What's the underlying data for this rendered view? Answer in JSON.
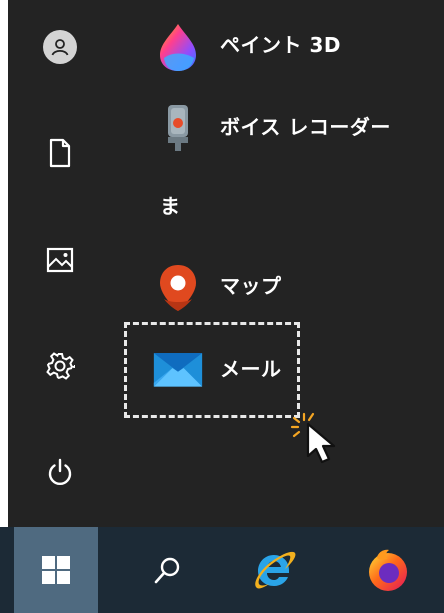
{
  "rail": {
    "items": [
      {
        "icon": "user-icon"
      },
      {
        "icon": "document-icon"
      },
      {
        "icon": "pictures-icon"
      },
      {
        "icon": "settings-gear-icon"
      },
      {
        "icon": "power-icon"
      }
    ]
  },
  "apps": {
    "paint3d": {
      "label": "ペイント 3D",
      "icon": "paint-3d-icon"
    },
    "voice_recorder": {
      "label": "ボイス レコーダー",
      "icon": "microphone-icon"
    },
    "group_letter": "ま",
    "maps": {
      "label": "マップ",
      "icon": "map-pin-icon"
    },
    "mail": {
      "label": "メール",
      "icon": "mail-envelope-icon"
    }
  },
  "taskbar": {
    "items": [
      {
        "icon": "windows-start-icon"
      },
      {
        "icon": "search-icon"
      },
      {
        "icon": "internet-explorer-icon"
      },
      {
        "icon": "firefox-icon"
      }
    ]
  },
  "colors": {
    "menu_bg": "#232323",
    "taskbar_bg": "#1c2a36",
    "start_highlight": "#4f6a80",
    "mail_blue": "#1e8fd9",
    "maps_red": "#e0491f"
  }
}
